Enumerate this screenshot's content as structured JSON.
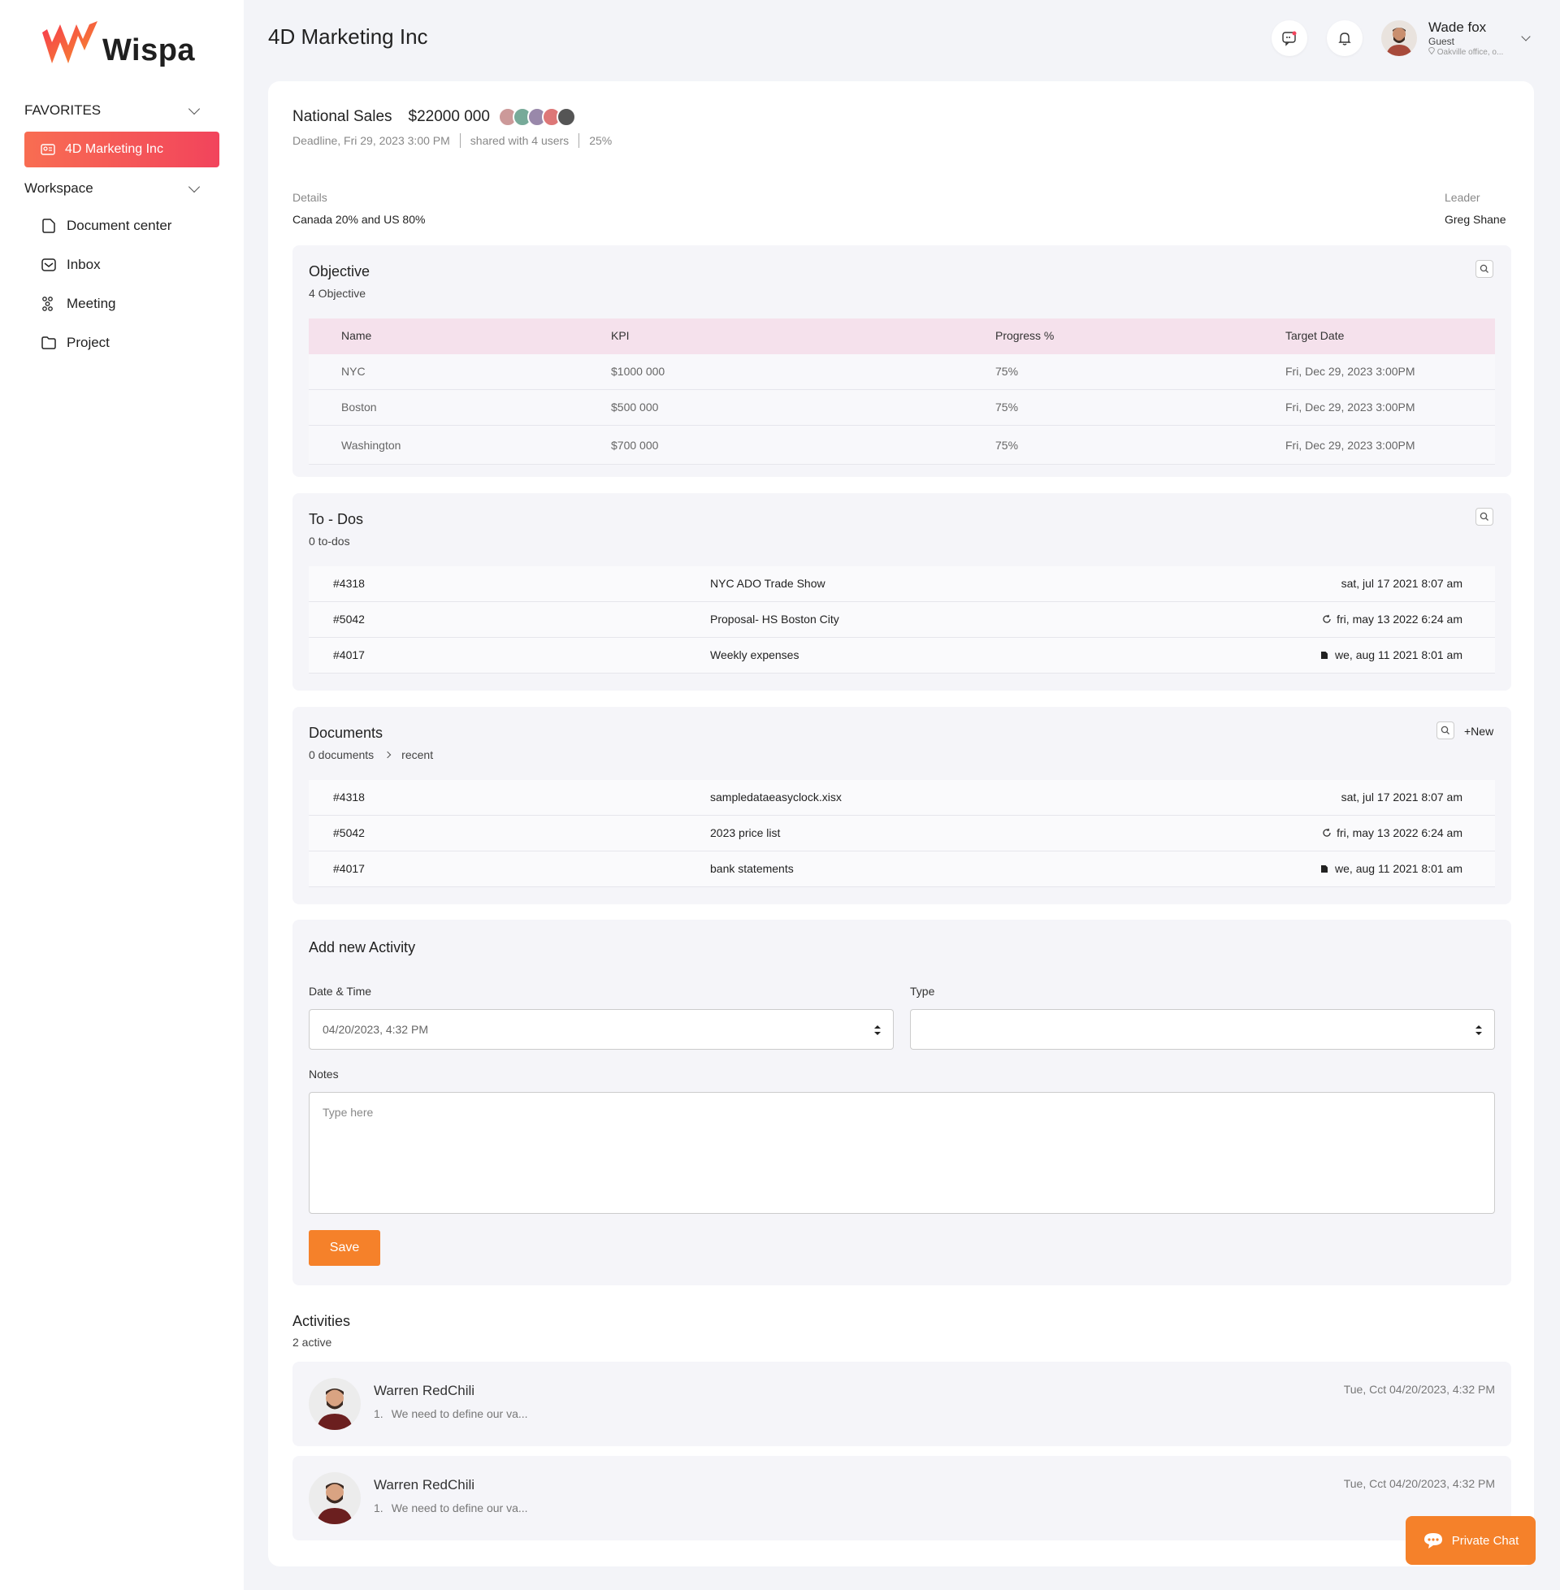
{
  "brand": {
    "name": "Wispa"
  },
  "sidebar": {
    "favorites_label": "FAVORITES",
    "favorite_active": "4D Marketing Inc",
    "workspace_label": "Workspace",
    "items": [
      {
        "label": "Document center",
        "icon": "document-icon"
      },
      {
        "label": "Inbox",
        "icon": "inbox-icon"
      },
      {
        "label": "Meeting",
        "icon": "meeting-icon"
      },
      {
        "label": "Project",
        "icon": "folder-icon"
      }
    ]
  },
  "header": {
    "title": "4D Marketing Inc",
    "user": {
      "name": "Wade fox",
      "role": "Guest",
      "location": "Oakville office, o..."
    }
  },
  "summary": {
    "name": "National Sales",
    "amount": "$22000 000",
    "deadline": "Deadline, Fri 29, 2023 3:00 PM",
    "shared": "shared with 4 users",
    "percent": "25%",
    "details_label": "Details",
    "details_value": "Canada 20% and US 80%",
    "leader_label": "Leader",
    "leader_value": "Greg Shane"
  },
  "objective": {
    "title": "Objective",
    "count": "4 Objective",
    "headers": [
      "Name",
      "KPI",
      "Progress %",
      "Target Date"
    ],
    "rows": [
      [
        "NYC",
        "$1000 000",
        "75%",
        "Fri, Dec 29, 2023 3:00PM"
      ],
      [
        "Boston",
        "$500 000",
        "75%",
        "Fri, Dec 29, 2023 3:00PM"
      ],
      [
        "Washington",
        "$700 000",
        "75%",
        "Fri, Dec 29, 2023 3:00PM"
      ]
    ]
  },
  "todos": {
    "title": "To - Dos",
    "count": "0 to-dos",
    "rows": [
      {
        "id": "#4318",
        "name": "NYC ADO Trade Show",
        "date": "sat, jul 17 2021 8:07 am"
      },
      {
        "id": "#5042",
        "name": "Proposal- HS Boston City",
        "date": "fri, may 13 2022 6:24 am"
      },
      {
        "id": "#4017",
        "name": "Weekly expenses",
        "date": "we, aug 11 2021 8:01 am"
      }
    ]
  },
  "documents": {
    "title": "Documents",
    "count": "0 documents",
    "filter": "recent",
    "new_label": "+New",
    "rows": [
      {
        "id": "#4318",
        "name": "sampledataeasyclock.xisx",
        "date": "sat, jul 17 2021 8:07 am"
      },
      {
        "id": "#5042",
        "name": "2023 price list",
        "date": "fri, may 13 2022 6:24 am"
      },
      {
        "id": "#4017",
        "name": "bank statements",
        "date": "we, aug 11 2021 8:01 am"
      }
    ]
  },
  "activity_form": {
    "title": "Add new Activity",
    "date_label": "Date & Time",
    "date_value": "04/20/2023, 4:32 PM",
    "type_label": "Type",
    "type_value": "",
    "notes_label": "Notes",
    "notes_placeholder": "Type here",
    "save_label": "Save"
  },
  "activities": {
    "title": "Activities",
    "count": "2 active",
    "items": [
      {
        "name": "Warren RedChili",
        "num": "1.",
        "note": "We need to define our va...",
        "date": "Tue, Cct 04/20/2023, 4:32 PM"
      },
      {
        "name": "Warren RedChili",
        "num": "1.",
        "note": "We need to define our va...",
        "date": "Tue, Cct 04/20/2023, 4:32 PM"
      }
    ]
  },
  "private_chat": {
    "label": "Private Chat"
  },
  "colors": {
    "accent": "#f5812a",
    "active_gradient_start": "#f86d52",
    "active_gradient_end": "#f2445c",
    "table_header": "#f5e1ec"
  }
}
